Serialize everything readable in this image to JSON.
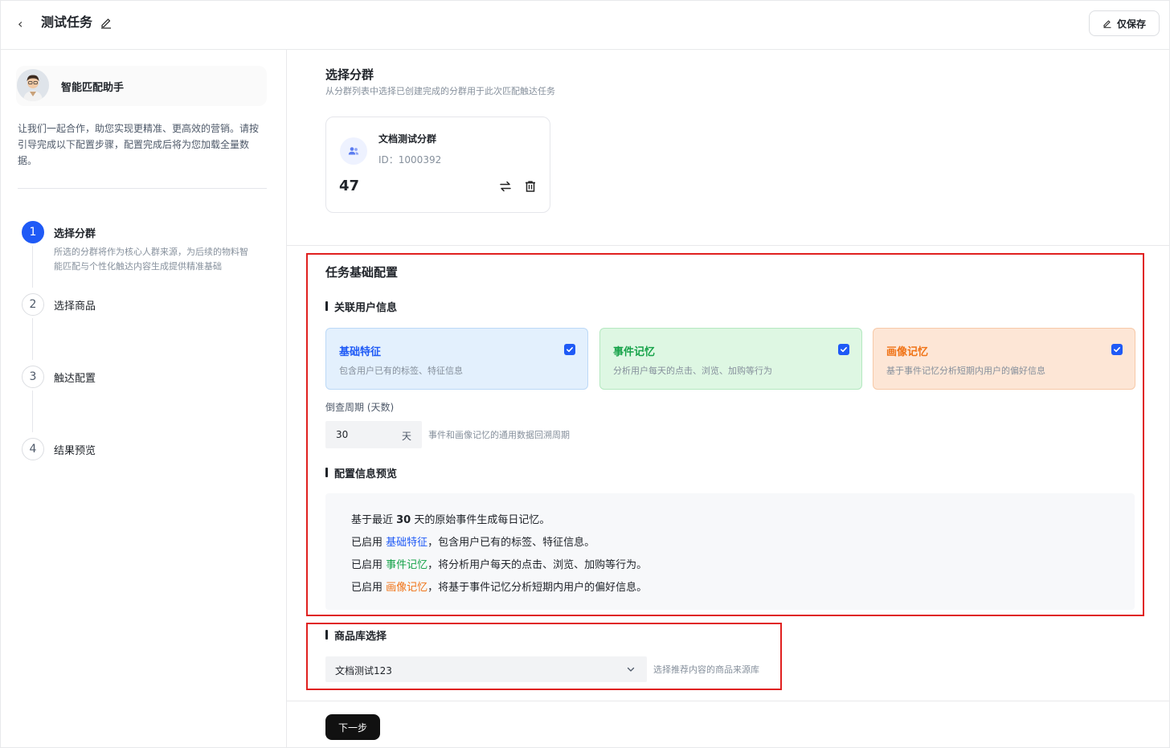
{
  "header": {
    "title": "测试任务",
    "save_label": "仅保存"
  },
  "sidebar": {
    "assistant_name": "智能匹配助手",
    "intro": "让我们一起合作，助您实现更精准、更高效的营销。请按引导完成以下配置步骤，配置完成后将为您加载全量数据。",
    "steps": [
      {
        "num": "1",
        "title": "选择分群",
        "desc": "所选的分群将作为核心人群来源，为后续的物料智能匹配与个性化触达内容生成提供精准基础"
      },
      {
        "num": "2",
        "title": "选择商品"
      },
      {
        "num": "3",
        "title": "触达配置"
      },
      {
        "num": "4",
        "title": "结果预览"
      }
    ]
  },
  "segment": {
    "title": "选择分群",
    "subtitle": "从分群列表中选择已创建完成的分群用于此次匹配触达任务",
    "card": {
      "name": "文档测试分群",
      "id": "ID：1000392",
      "count": "47"
    }
  },
  "config": {
    "title": "任务基础配置",
    "user_info_heading": "关联用户信息",
    "cards": [
      {
        "title": "基础特征",
        "desc": "包含用户已有的标签、特征信息",
        "color": "#1f5af6",
        "bg": "#e3f0fd",
        "border": "#bcd9f7"
      },
      {
        "title": "事件记忆",
        "desc": "分析用户每天的点击、浏览、加购等行为",
        "color": "#17a34a",
        "bg": "#def7e3",
        "border": "#b4e8c0"
      },
      {
        "title": "画像记忆",
        "desc": "基于事件记忆分析短期内用户的偏好信息",
        "color": "#f07316",
        "bg": "#fde6d6",
        "border": "#f7c9a8"
      }
    ],
    "lookback_label": "倒查周期 (天数)",
    "lookback_value": "30",
    "lookback_unit": "天",
    "lookback_hint": "事件和画像记忆的通用数据回溯周期",
    "preview_heading": "配置信息预览",
    "preview": {
      "l1_a": "基于最近 ",
      "l1_b": "30",
      "l1_c": " 天的原始事件生成每日记忆。",
      "enabled": "已启用 ",
      "l2_hl": "基础特征",
      "l2_rest": "，包含用户已有的标签、特征信息。",
      "l3_hl": "事件记忆",
      "l3_rest": "，将分析用户每天的点击、浏览、加购等行为。",
      "l4_hl": "画像记忆",
      "l4_rest": "，将基于事件记忆分析短期内用户的偏好信息。"
    }
  },
  "product": {
    "heading": "商品库选择",
    "selected": "文档测试123",
    "hint": "选择推荐内容的商品来源库"
  },
  "footer": {
    "next_label": "下一步"
  },
  "colors": {
    "accent": "#1f5af6",
    "highlight_border": "#e0201f"
  }
}
